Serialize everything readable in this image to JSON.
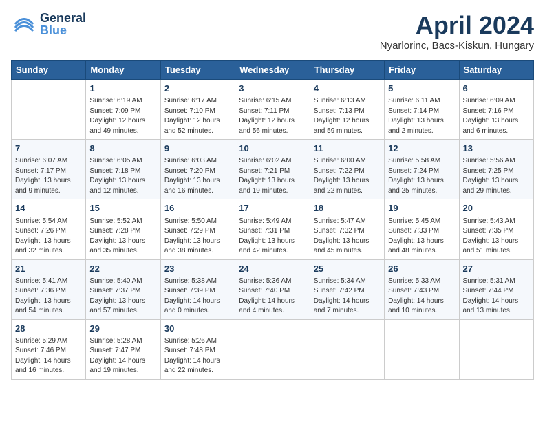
{
  "header": {
    "logo_general": "General",
    "logo_blue": "Blue",
    "month_title": "April 2024",
    "location": "Nyarlorinc, Bacs-Kiskun, Hungary"
  },
  "days_of_week": [
    "Sunday",
    "Monday",
    "Tuesday",
    "Wednesday",
    "Thursday",
    "Friday",
    "Saturday"
  ],
  "weeks": [
    [
      {
        "day": "",
        "sunrise": "",
        "sunset": "",
        "daylight": ""
      },
      {
        "day": "1",
        "sunrise": "Sunrise: 6:19 AM",
        "sunset": "Sunset: 7:09 PM",
        "daylight": "Daylight: 12 hours and 49 minutes."
      },
      {
        "day": "2",
        "sunrise": "Sunrise: 6:17 AM",
        "sunset": "Sunset: 7:10 PM",
        "daylight": "Daylight: 12 hours and 52 minutes."
      },
      {
        "day": "3",
        "sunrise": "Sunrise: 6:15 AM",
        "sunset": "Sunset: 7:11 PM",
        "daylight": "Daylight: 12 hours and 56 minutes."
      },
      {
        "day": "4",
        "sunrise": "Sunrise: 6:13 AM",
        "sunset": "Sunset: 7:13 PM",
        "daylight": "Daylight: 12 hours and 59 minutes."
      },
      {
        "day": "5",
        "sunrise": "Sunrise: 6:11 AM",
        "sunset": "Sunset: 7:14 PM",
        "daylight": "Daylight: 13 hours and 2 minutes."
      },
      {
        "day": "6",
        "sunrise": "Sunrise: 6:09 AM",
        "sunset": "Sunset: 7:16 PM",
        "daylight": "Daylight: 13 hours and 6 minutes."
      }
    ],
    [
      {
        "day": "7",
        "sunrise": "Sunrise: 6:07 AM",
        "sunset": "Sunset: 7:17 PM",
        "daylight": "Daylight: 13 hours and 9 minutes."
      },
      {
        "day": "8",
        "sunrise": "Sunrise: 6:05 AM",
        "sunset": "Sunset: 7:18 PM",
        "daylight": "Daylight: 13 hours and 12 minutes."
      },
      {
        "day": "9",
        "sunrise": "Sunrise: 6:03 AM",
        "sunset": "Sunset: 7:20 PM",
        "daylight": "Daylight: 13 hours and 16 minutes."
      },
      {
        "day": "10",
        "sunrise": "Sunrise: 6:02 AM",
        "sunset": "Sunset: 7:21 PM",
        "daylight": "Daylight: 13 hours and 19 minutes."
      },
      {
        "day": "11",
        "sunrise": "Sunrise: 6:00 AM",
        "sunset": "Sunset: 7:22 PM",
        "daylight": "Daylight: 13 hours and 22 minutes."
      },
      {
        "day": "12",
        "sunrise": "Sunrise: 5:58 AM",
        "sunset": "Sunset: 7:24 PM",
        "daylight": "Daylight: 13 hours and 25 minutes."
      },
      {
        "day": "13",
        "sunrise": "Sunrise: 5:56 AM",
        "sunset": "Sunset: 7:25 PM",
        "daylight": "Daylight: 13 hours and 29 minutes."
      }
    ],
    [
      {
        "day": "14",
        "sunrise": "Sunrise: 5:54 AM",
        "sunset": "Sunset: 7:26 PM",
        "daylight": "Daylight: 13 hours and 32 minutes."
      },
      {
        "day": "15",
        "sunrise": "Sunrise: 5:52 AM",
        "sunset": "Sunset: 7:28 PM",
        "daylight": "Daylight: 13 hours and 35 minutes."
      },
      {
        "day": "16",
        "sunrise": "Sunrise: 5:50 AM",
        "sunset": "Sunset: 7:29 PM",
        "daylight": "Daylight: 13 hours and 38 minutes."
      },
      {
        "day": "17",
        "sunrise": "Sunrise: 5:49 AM",
        "sunset": "Sunset: 7:31 PM",
        "daylight": "Daylight: 13 hours and 42 minutes."
      },
      {
        "day": "18",
        "sunrise": "Sunrise: 5:47 AM",
        "sunset": "Sunset: 7:32 PM",
        "daylight": "Daylight: 13 hours and 45 minutes."
      },
      {
        "day": "19",
        "sunrise": "Sunrise: 5:45 AM",
        "sunset": "Sunset: 7:33 PM",
        "daylight": "Daylight: 13 hours and 48 minutes."
      },
      {
        "day": "20",
        "sunrise": "Sunrise: 5:43 AM",
        "sunset": "Sunset: 7:35 PM",
        "daylight": "Daylight: 13 hours and 51 minutes."
      }
    ],
    [
      {
        "day": "21",
        "sunrise": "Sunrise: 5:41 AM",
        "sunset": "Sunset: 7:36 PM",
        "daylight": "Daylight: 13 hours and 54 minutes."
      },
      {
        "day": "22",
        "sunrise": "Sunrise: 5:40 AM",
        "sunset": "Sunset: 7:37 PM",
        "daylight": "Daylight: 13 hours and 57 minutes."
      },
      {
        "day": "23",
        "sunrise": "Sunrise: 5:38 AM",
        "sunset": "Sunset: 7:39 PM",
        "daylight": "Daylight: 14 hours and 0 minutes."
      },
      {
        "day": "24",
        "sunrise": "Sunrise: 5:36 AM",
        "sunset": "Sunset: 7:40 PM",
        "daylight": "Daylight: 14 hours and 4 minutes."
      },
      {
        "day": "25",
        "sunrise": "Sunrise: 5:34 AM",
        "sunset": "Sunset: 7:42 PM",
        "daylight": "Daylight: 14 hours and 7 minutes."
      },
      {
        "day": "26",
        "sunrise": "Sunrise: 5:33 AM",
        "sunset": "Sunset: 7:43 PM",
        "daylight": "Daylight: 14 hours and 10 minutes."
      },
      {
        "day": "27",
        "sunrise": "Sunrise: 5:31 AM",
        "sunset": "Sunset: 7:44 PM",
        "daylight": "Daylight: 14 hours and 13 minutes."
      }
    ],
    [
      {
        "day": "28",
        "sunrise": "Sunrise: 5:29 AM",
        "sunset": "Sunset: 7:46 PM",
        "daylight": "Daylight: 14 hours and 16 minutes."
      },
      {
        "day": "29",
        "sunrise": "Sunrise: 5:28 AM",
        "sunset": "Sunset: 7:47 PM",
        "daylight": "Daylight: 14 hours and 19 minutes."
      },
      {
        "day": "30",
        "sunrise": "Sunrise: 5:26 AM",
        "sunset": "Sunset: 7:48 PM",
        "daylight": "Daylight: 14 hours and 22 minutes."
      },
      {
        "day": "",
        "sunrise": "",
        "sunset": "",
        "daylight": ""
      },
      {
        "day": "",
        "sunrise": "",
        "sunset": "",
        "daylight": ""
      },
      {
        "day": "",
        "sunrise": "",
        "sunset": "",
        "daylight": ""
      },
      {
        "day": "",
        "sunrise": "",
        "sunset": "",
        "daylight": ""
      }
    ]
  ]
}
